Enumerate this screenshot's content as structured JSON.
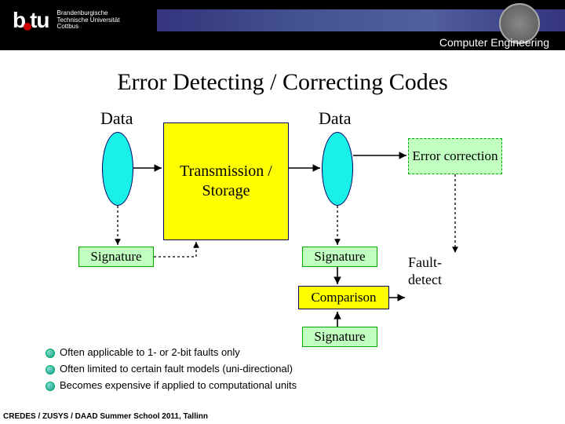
{
  "header": {
    "logo_text": "b·tu",
    "logo_sub": "Brandenburgische\nTechnische Universität\nCottbus",
    "department": "Computer Engineering"
  },
  "slide": {
    "title": "Error Detecting / Correcting Codes"
  },
  "diagram": {
    "data_left": "Data",
    "data_right": "Data",
    "transmission": "Transmission / Storage",
    "error_correction": "Error correction",
    "signature_left": "Signature",
    "signature_right": "Signature",
    "signature_bottom": "Signature",
    "comparison": "Comparison",
    "fault_detect": "Fault-\ndetect"
  },
  "bullets": [
    "Often applicable to 1- or 2-bit faults only",
    "Often limited to certain fault models (uni-directional)",
    "Becomes expensive if applied to computational units"
  ],
  "footer": "CREDES / ZUSYS / DAAD Summer School 2011, Tallinn"
}
